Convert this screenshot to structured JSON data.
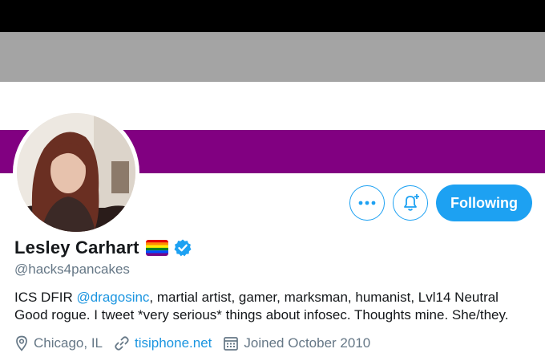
{
  "banner": {
    "stripes": [
      "#000000",
      "#a4a4a4",
      "#ffffff",
      "#810081"
    ]
  },
  "profile": {
    "name": "Lesley Carhart",
    "handle": "@hacks4pancakes",
    "name_badges": [
      "rainbow-flag-icon",
      "verified-badge-icon"
    ],
    "bio": {
      "part1": "ICS DFIR ",
      "mention": "@dragosinc",
      "part2": ", martial artist, gamer, marksman, humanist, Lvl14 Neutral Good rogue. I tweet *very serious* things about infosec. Thoughts mine. She/they."
    },
    "location": "Chicago, IL",
    "website": "tisiphone.net",
    "joined": "Joined October 2010"
  },
  "actions": {
    "more_icon": "more-icon",
    "notify_icon": "bell-plus-icon",
    "following_label": "Following"
  },
  "colors": {
    "accent": "#1da1f2",
    "link": "#1b95e0",
    "secondary_text": "#657786"
  }
}
